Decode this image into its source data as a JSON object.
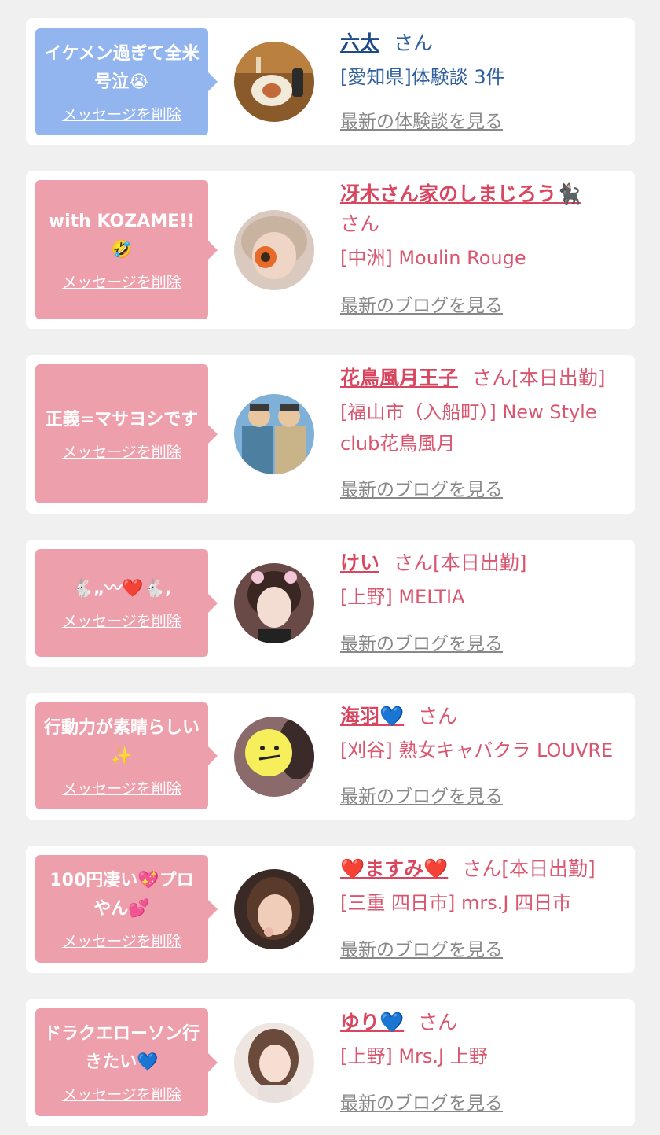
{
  "entries": [
    {
      "message": "イケメン過ぎて全米号泣😭",
      "delete_label": "メッセージを削除",
      "name": "六太",
      "honorific": "さん",
      "status": "",
      "shop": "[愛知県]体験談 3件",
      "more_label": "最新の体験談を見る",
      "bubble_color": "#92b4ef",
      "avatar_icon": "food-photo-avatar"
    },
    {
      "message": "with KOZAME!!🤣",
      "delete_label": "メッセージを削除",
      "name": "冴木さん家のしまじろう🐈‍⬛",
      "honorific": "さん",
      "status": "",
      "shop": "[中洲] Moulin Rouge",
      "more_label": "最新のブログを見る",
      "bubble_color": "#ee9fac",
      "avatar_icon": "flower-face-avatar"
    },
    {
      "message": "正義=マサヨシです",
      "delete_label": "メッセージを削除",
      "name": "花鳥風月王子",
      "honorific": "さん",
      "status": "[本日出勤]",
      "shop": "[福山市（入船町）] New Style club花鳥風月",
      "more_label": "最新のブログを見る",
      "bubble_color": "#ee9fac",
      "avatar_icon": "anime-couple-avatar"
    },
    {
      "message": "🐇„〰❤️🐇,",
      "delete_label": "メッセージを削除",
      "name": "けい",
      "honorific": "さん",
      "status": "[本日出勤]",
      "shop": "[上野] MELTIA",
      "more_label": "最新のブログを見る",
      "bubble_color": "#ee9fac",
      "avatar_icon": "woman-avatar"
    },
    {
      "message": "行動力が素晴らしい✨",
      "delete_label": "メッセージを削除",
      "name": "海羽💙",
      "honorific": "さん",
      "status": "",
      "shop": "[刈谷] 熟女キャバクラ LOUVRE",
      "more_label": "最新のブログを見る",
      "bubble_color": "#ee9fac",
      "avatar_icon": "smiley-face-avatar"
    },
    {
      "message": "100円凄い💖プロやん💕",
      "delete_label": "メッセージを削除",
      "name": "❤️ますみ❤️",
      "honorific": "さん",
      "status": "[本日出勤]",
      "shop": "[三重 四日市] mrs.J 四日市",
      "more_label": "最新のブログを見る",
      "bubble_color": "#ee9fac",
      "avatar_icon": "woman-selfie-avatar"
    },
    {
      "message": "ドラクエローソン行きたい💙",
      "delete_label": "メッセージを削除",
      "name": "ゆり💙",
      "honorific": "さん",
      "status": "",
      "shop": "[上野] Mrs.J 上野",
      "more_label": "最新のブログを見る",
      "bubble_color": "#ee9fac",
      "avatar_icon": "woman-portrait-avatar"
    }
  ]
}
